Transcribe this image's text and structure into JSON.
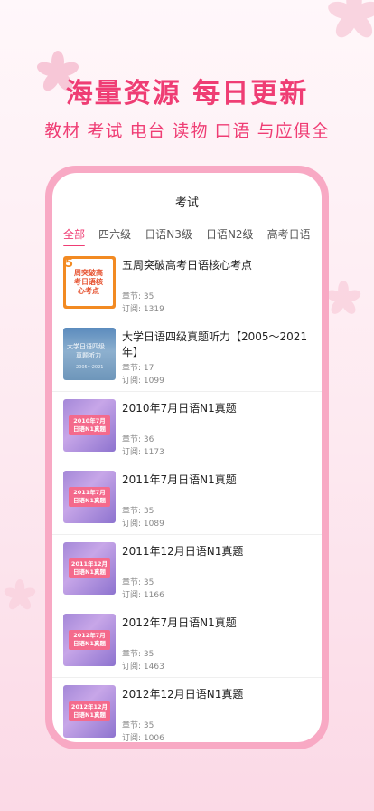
{
  "headline": "海量资源  每日更新",
  "subline": "教材 考试 电台 读物 口语 与应俱全",
  "screen": {
    "title": "考试",
    "tabs": [
      {
        "label": "全部",
        "active": true
      },
      {
        "label": "四六级",
        "active": false
      },
      {
        "label": "日语N3级",
        "active": false
      },
      {
        "label": "日语N2级",
        "active": false
      },
      {
        "label": "高考日语",
        "active": false
      }
    ],
    "chapter_prefix": "章节: ",
    "subscribe_prefix": "订阅: ",
    "items": [
      {
        "title": "五周突破高考日语核心考点",
        "chapters": "35",
        "subscribers": "1319",
        "cover": {
          "style": "orange",
          "num": "5",
          "text": "周突破高考日语核心考点"
        }
      },
      {
        "title": "大学日语四级真题听力【2005～2021年】",
        "chapters": "17",
        "subscribers": "1099",
        "cover": {
          "style": "blue",
          "line1": "大学日语四级",
          "line2": "真题听力",
          "line3": "2005～2021"
        }
      },
      {
        "title": "2010年7月日语N1真题",
        "chapters": "36",
        "subscribers": "1173",
        "cover": {
          "style": "pink",
          "text": "2010年7月日语N1真题"
        }
      },
      {
        "title": "2011年7月日语N1真题",
        "chapters": "35",
        "subscribers": "1089",
        "cover": {
          "style": "pink",
          "text": "2011年7月日语N1真题"
        }
      },
      {
        "title": "2011年12月日语N1真题",
        "chapters": "35",
        "subscribers": "1166",
        "cover": {
          "style": "pink",
          "text": "2011年12月日语N1真题"
        }
      },
      {
        "title": "2012年7月日语N1真题",
        "chapters": "35",
        "subscribers": "1463",
        "cover": {
          "style": "pink",
          "text": "2012年7月日语N1真题"
        }
      },
      {
        "title": "2012年12月日语N1真题",
        "chapters": "35",
        "subscribers": "1006",
        "cover": {
          "style": "pink",
          "text": "2012年12月日语N1真题"
        }
      }
    ]
  },
  "colors": {
    "accent": "#ef3d74",
    "frame": "#f8a9c4"
  }
}
